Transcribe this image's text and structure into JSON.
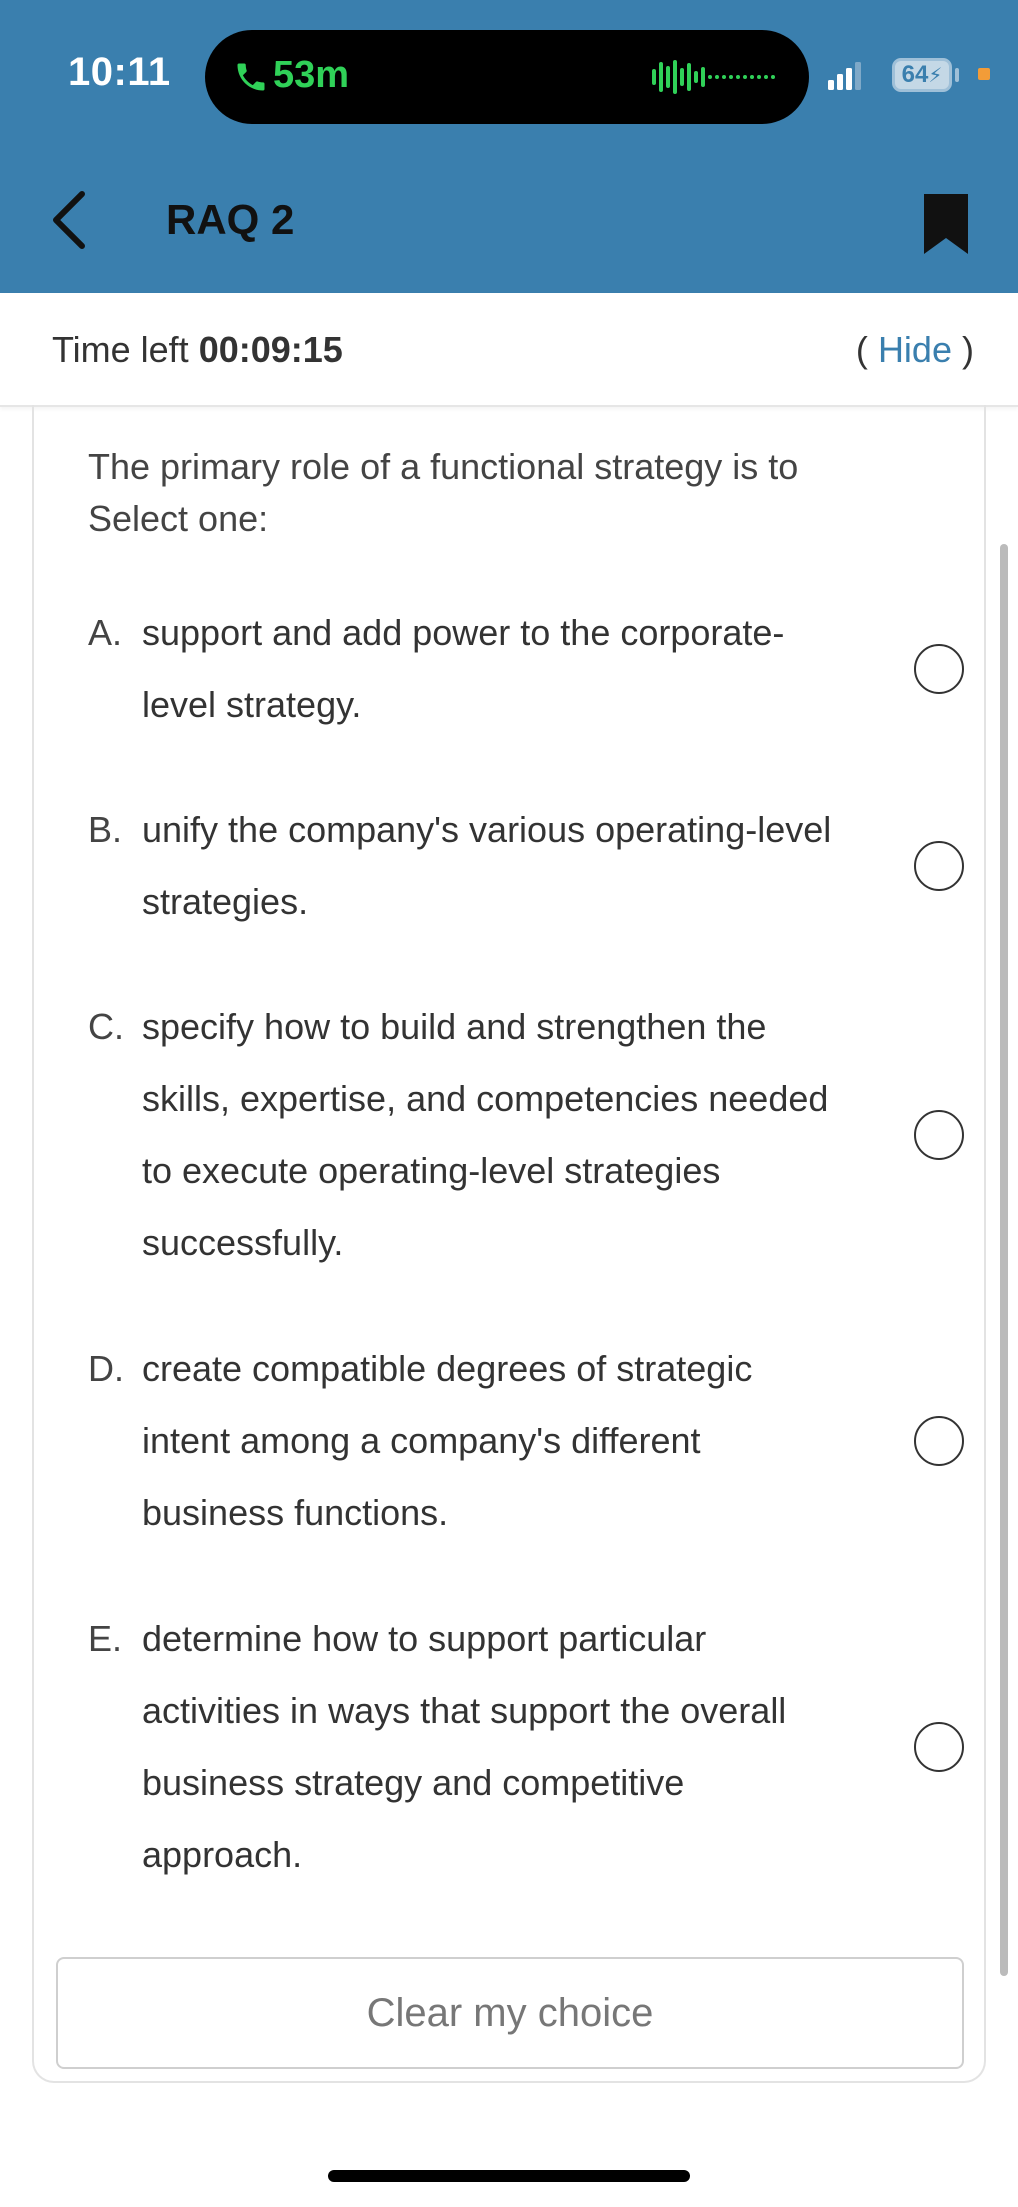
{
  "status_bar": {
    "time": "10:11",
    "call_duration": "53m",
    "battery": "64"
  },
  "nav": {
    "title": "RAQ 2"
  },
  "timer": {
    "label": "Time left",
    "value": "00:09:15",
    "open_paren": "(",
    "hide_label": "Hide",
    "close_paren": ")"
  },
  "question": {
    "text": "The primary role of a functional strategy is to",
    "instruction": "Select one:"
  },
  "options": [
    {
      "letter": "A.",
      "text": "support and add power to the corporate-level strategy."
    },
    {
      "letter": "B.",
      "text": "unify the company's various operating-level strategies."
    },
    {
      "letter": "C.",
      "text": "specify how to build and strengthen the skills, expertise, and competencies needed to execute operating-level strategies successfully."
    },
    {
      "letter": "D.",
      "text": "create compatible degrees of strategic intent among a company's different business functions."
    },
    {
      "letter": "E.",
      "text": "determine how to support particular activities in ways that support the overall business strategy and competitive approach."
    }
  ],
  "actions": {
    "clear_label": "Clear my choice"
  },
  "colors": {
    "header_bg": "#3a7fae",
    "call_green": "#30d158",
    "link_blue": "#3a7fae"
  }
}
